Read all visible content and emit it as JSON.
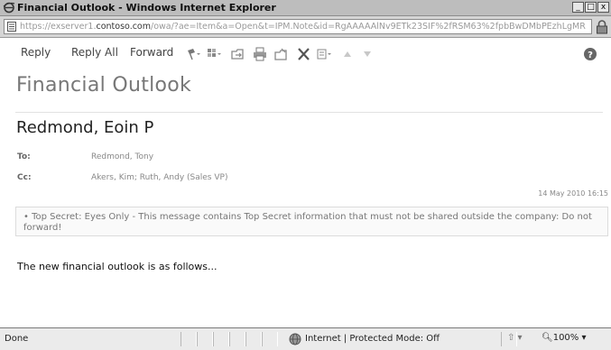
{
  "window": {
    "title": "Financial Outlook - Windows Internet Explorer",
    "controls": [
      "_",
      "□",
      "x"
    ]
  },
  "address_bar": {
    "url_prefix": "https://exserver1.",
    "url_domain": "contoso.com",
    "url_rest": "/owa/?ae=Item&a=Open&t=IPM.Note&id=RgAAAAAlNv9ETk23SIF%2fRSM63%2fpbBwDMbPEzhLgMR"
  },
  "toolbar": {
    "reply_label": "Reply",
    "reply_all_label": "Reply All",
    "forward_label": "Forward"
  },
  "message": {
    "subject": "Financial Outlook",
    "sender": "Redmond, Eoin P",
    "to_label": "To:",
    "to_value": "Redmond, Tony",
    "cc_label": "Cc:",
    "cc_value": "Akers, Kim; Ruth, Andy (Sales VP)",
    "date": "14 May 2010 16:15",
    "banner": "• Top Secret: Eyes Only - This message contains Top Secret information that must not be shared outside the company: Do not forward!",
    "body": "The new financial outlook is as follows..."
  },
  "status_bar": {
    "status": "Done",
    "zone": "Internet | Protected Mode: Off",
    "zoom": "100%"
  },
  "colors": {
    "title_bar": "#bdbdbd",
    "status_bar": "#ebebeb"
  }
}
